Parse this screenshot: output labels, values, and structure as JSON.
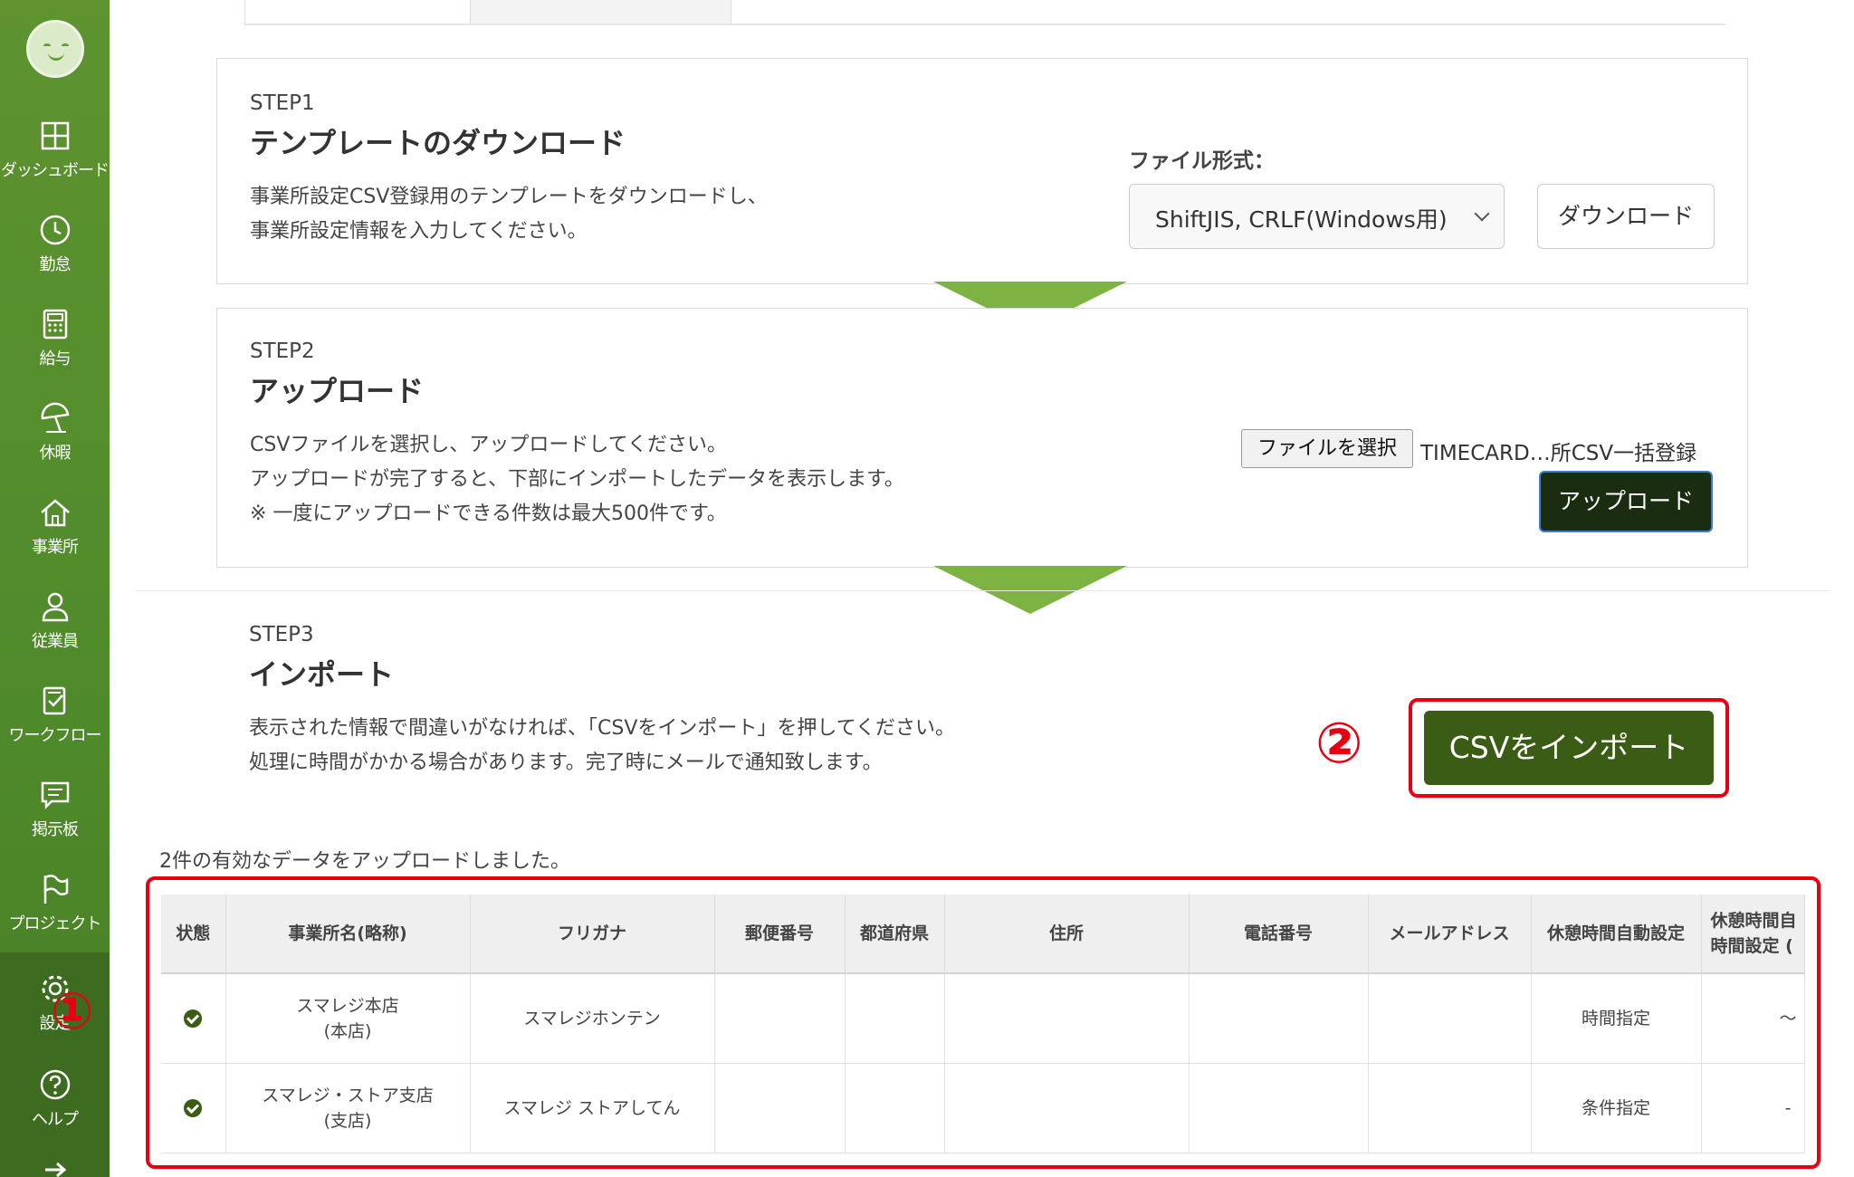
{
  "sidebar": {
    "items": [
      {
        "label": "ダッシュボード",
        "icon": "dashboard-icon"
      },
      {
        "label": "勤怠",
        "icon": "clock-icon"
      },
      {
        "label": "給与",
        "icon": "calculator-icon"
      },
      {
        "label": "休暇",
        "icon": "beach-umbrella-icon"
      },
      {
        "label": "事業所",
        "icon": "home-icon"
      },
      {
        "label": "従業員",
        "icon": "person-icon"
      },
      {
        "label": "ワークフロー",
        "icon": "clipboard-check-icon"
      },
      {
        "label": "掲示板",
        "icon": "message-board-icon"
      },
      {
        "label": "プロジェクト",
        "icon": "flag-icon"
      },
      {
        "label": "設定",
        "icon": "gear-icon"
      },
      {
        "label": "ヘルプ",
        "icon": "help-icon"
      }
    ]
  },
  "annotations": {
    "marker1": "①",
    "marker2": "②",
    "color": "#e60012"
  },
  "step1": {
    "label": "STEP1",
    "title": "テンプレートのダウンロード",
    "desc_line1": "事業所設定CSV登録用のテンプレートをダウンロードし、",
    "desc_line2": "事業所設定情報を入力してください。",
    "format_label": "ファイル形式：",
    "format_value": "ShiftJIS, CRLF(Windows用)",
    "download_button": "ダウンロード"
  },
  "step2": {
    "label": "STEP2",
    "title": "アップロード",
    "desc_line1": "CSVファイルを選択し、アップロードしてください。",
    "desc_line2": "アップロードが完了すると、下部にインポートしたデータを表示します。",
    "desc_line3": "※ 一度にアップロードできる件数は最大500件です。",
    "file_button": "ファイルを選択",
    "file_name": "TIMECARD…所CSV一括登録",
    "upload_button": "アップロード"
  },
  "step3": {
    "label": "STEP3",
    "title": "インポート",
    "desc_line1": "表示された情報で間違いがなければ、「CSVをインポート」を押してください。",
    "desc_line2": "処理に時間がかかる場合があります。完了時にメールで通知致します。",
    "import_button": "CSVをインポート"
  },
  "upload_message": "2件の有効なデータをアップロードしました。",
  "table": {
    "headers": [
      "状態",
      "事業所名(略称)",
      "フリガナ",
      "郵便番号",
      "都道府県",
      "住所",
      "電話番号",
      "メールアドレス",
      "休憩時間自動設定",
      "休憩時間自\n時間設定 ("
    ],
    "rows": [
      {
        "status": "valid",
        "name": "スマレジ本店",
        "short": "(本店)",
        "kana": "スマレジホンテン",
        "zip": "",
        "pref": "",
        "address": "",
        "phone": "",
        "email": "",
        "break_auto": "時間指定",
        "break_time": "〜"
      },
      {
        "status": "valid",
        "name": "スマレジ・ストア支店",
        "short": "(支店)",
        "kana": "スマレジ ストアしてん",
        "zip": "",
        "pref": "",
        "address": "",
        "phone": "",
        "email": "",
        "break_auto": "条件指定",
        "break_time": "-"
      }
    ]
  },
  "colors": {
    "sidebar_green": "#5e9330",
    "accent_arrow": "#7cb342",
    "import_button": "#3a5c14",
    "upload_button": "#1a2d10"
  }
}
